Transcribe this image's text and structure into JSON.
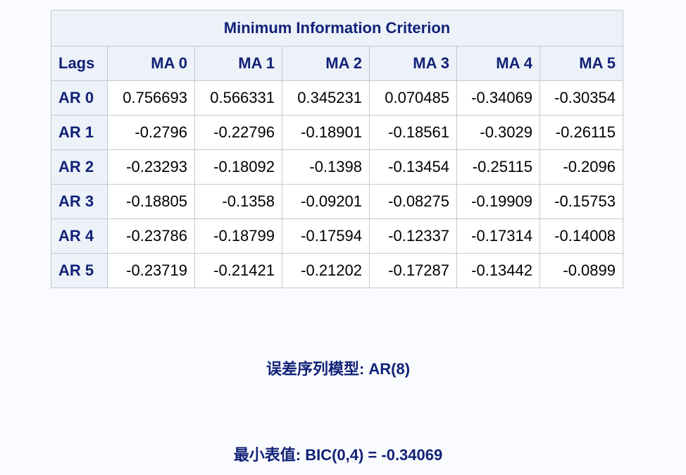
{
  "table": {
    "title": "Minimum Information Criterion",
    "corner_label": "Lags",
    "columns": [
      "MA 0",
      "MA 1",
      "MA 2",
      "MA 3",
      "MA 4",
      "MA 5"
    ],
    "rows": [
      {
        "label": "AR 0",
        "values": [
          "0.756693",
          "0.566331",
          "0.345231",
          "0.070485",
          "-0.34069",
          "-0.30354"
        ]
      },
      {
        "label": "AR 1",
        "values": [
          "-0.2796",
          "-0.22796",
          "-0.18901",
          "-0.18561",
          "-0.3029",
          "-0.26115"
        ]
      },
      {
        "label": "AR 2",
        "values": [
          "-0.23293",
          "-0.18092",
          "-0.1398",
          "-0.13454",
          "-0.25115",
          "-0.2096"
        ]
      },
      {
        "label": "AR 3",
        "values": [
          "-0.18805",
          "-0.1358",
          "-0.09201",
          "-0.08275",
          "-0.19909",
          "-0.15753"
        ]
      },
      {
        "label": "AR 4",
        "values": [
          "-0.23786",
          "-0.18799",
          "-0.17594",
          "-0.12337",
          "-0.17314",
          "-0.14008"
        ]
      },
      {
        "label": "AR 5",
        "values": [
          "-0.23719",
          "-0.21421",
          "-0.21202",
          "-0.17287",
          "-0.13442",
          "-0.0899"
        ]
      }
    ]
  },
  "notes": {
    "error_series_model": "误差序列模型: AR(8)",
    "minimum_value": "最小表值: BIC(0,4) = -0.34069"
  },
  "colors": {
    "header_text": "#112277",
    "header_background": "#edf2f9",
    "border": "#c5c9d1",
    "page_background": "#fafbfe"
  }
}
